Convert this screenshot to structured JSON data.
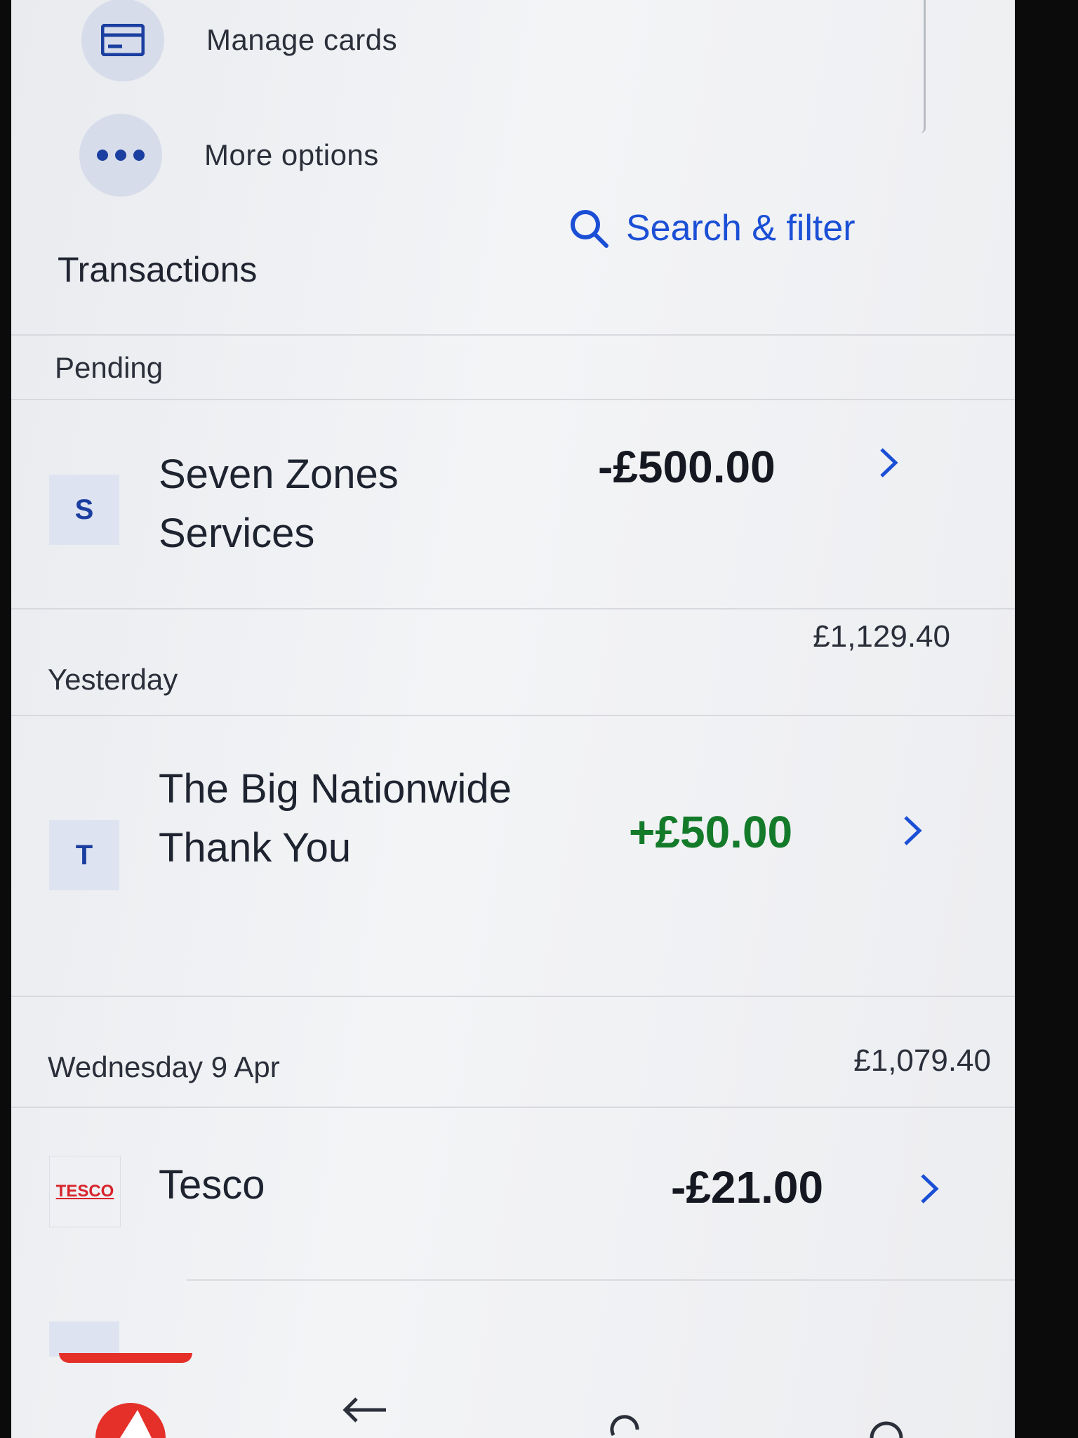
{
  "quick_actions": [
    {
      "label": "Manage cards",
      "icon": "card-icon"
    },
    {
      "label": "More options",
      "icon": "more-dots-icon"
    }
  ],
  "transactions": {
    "title": "Transactions",
    "search_label": "Search & filter",
    "groups": [
      {
        "label": "Pending",
        "total": "",
        "items": [
          {
            "initial": "S",
            "merchant": "Seven Zones Services",
            "amount": "-£500.00",
            "type": "debit"
          }
        ]
      },
      {
        "label": "Yesterday",
        "total": "£1,129.40",
        "items": [
          {
            "initial": "T",
            "merchant": "The Big Nationwide Thank You",
            "amount": "+£50.00",
            "type": "credit"
          }
        ]
      },
      {
        "label": "Wednesday 9 Apr",
        "total": "£1,079.40",
        "items": [
          {
            "initial": "TESCO",
            "merchant": "Tesco",
            "amount": "-£21.00",
            "type": "debit"
          }
        ]
      }
    ]
  },
  "nav": {
    "icons": [
      "app-logo-icon",
      "back-arrow-icon",
      "refresh-icon",
      "home-icon"
    ]
  },
  "colors": {
    "accent": "#1b4fd6",
    "credit": "#137a2a",
    "brand_red": "#e5302a"
  }
}
